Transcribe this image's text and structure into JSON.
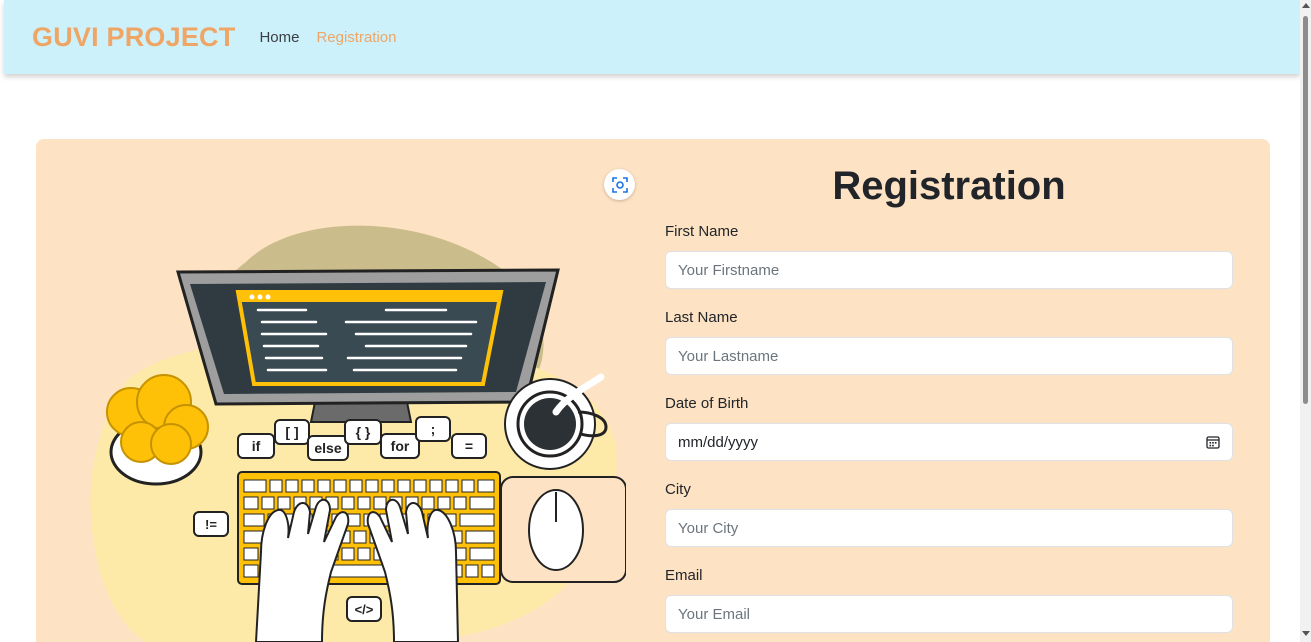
{
  "navbar": {
    "brand": "GUVI PROJECT",
    "links": [
      {
        "label": "Home",
        "active": false
      },
      {
        "label": "Registration",
        "active": true
      }
    ]
  },
  "form": {
    "title": "Registration",
    "fields": [
      {
        "label": "First Name",
        "placeholder": "Your Firstname"
      },
      {
        "label": "Last Name",
        "placeholder": "Your Lastname"
      },
      {
        "label": "Date of Birth",
        "placeholder": "mm/dd/yyyy"
      },
      {
        "label": "City",
        "placeholder": "Your City"
      },
      {
        "label": "Email",
        "placeholder": "Your Email"
      }
    ]
  },
  "illustration": {
    "code_bubbles": [
      "if",
      "[ ]",
      "else",
      "{ }",
      "for",
      ";",
      "=",
      "!=",
      "</>"
    ]
  },
  "colors": {
    "navbar_bg": "#cdf1fb",
    "brand": "#eea565",
    "card_bg": "#fde2c3",
    "accent_yellow": "#ffc107"
  },
  "icons": [
    "scan-icon",
    "calendar-icon"
  ]
}
